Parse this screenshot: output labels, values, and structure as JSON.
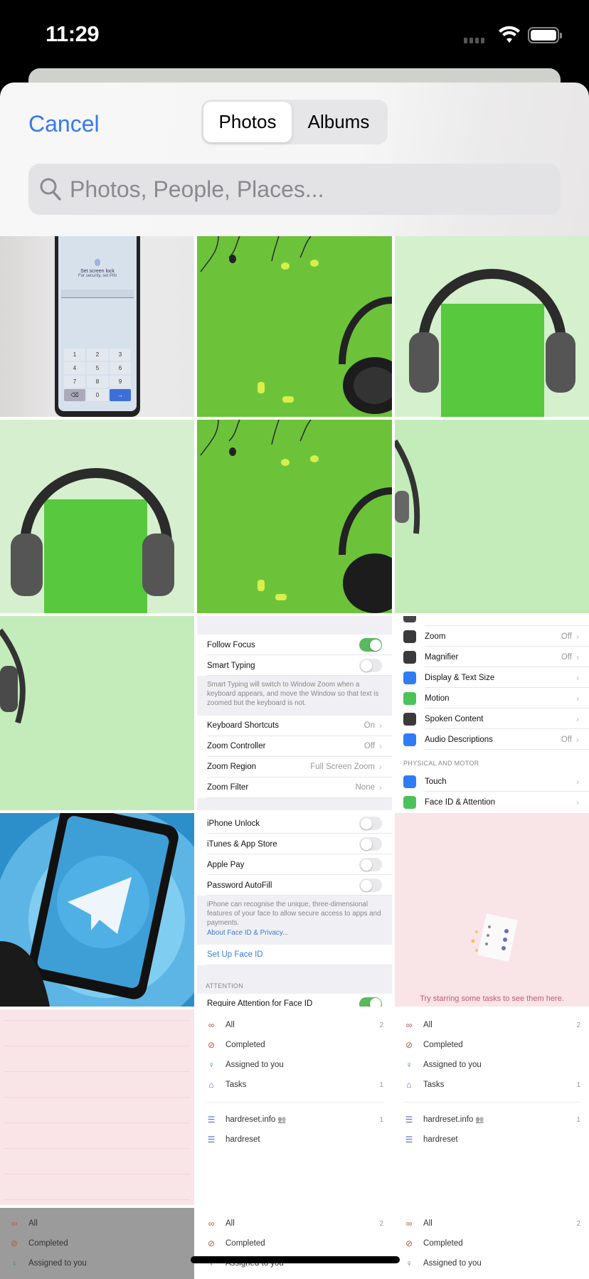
{
  "status_bar": {
    "time": "11:29"
  },
  "header": {
    "cancel_label": "Cancel",
    "tabs": [
      {
        "label": "Photos",
        "selected": true
      },
      {
        "label": "Albums",
        "selected": false
      }
    ],
    "search_placeholder": "Photos, People, Places..."
  },
  "colors": {
    "accent": "#3478f6",
    "toggle_on": "#5cb85c",
    "pink_bg": "#f9e4e8",
    "photo_green": "#6cc33a"
  },
  "photos": {
    "phone_lock": {
      "title": "Set screen lock",
      "subtitle": "For security, set PIN",
      "keys": [
        "1",
        "2",
        "3",
        "4",
        "5",
        "6",
        "7",
        "8",
        "9",
        "⌫",
        "0",
        "→"
      ]
    },
    "zoom_settings": {
      "rows": [
        {
          "type": "gap"
        },
        {
          "type": "row",
          "label": "Follow Focus",
          "toggle": true
        },
        {
          "type": "row",
          "label": "Smart Typing",
          "toggle": false
        },
        {
          "type": "footer",
          "text": "Smart Typing will switch to Window Zoom when a keyboard appears, and move the Window so that text is zoomed but the keyboard is not."
        },
        {
          "type": "row",
          "label": "Keyboard Shortcuts",
          "value": "On"
        },
        {
          "type": "row",
          "label": "Zoom Controller",
          "value": "Off"
        },
        {
          "type": "row",
          "label": "Zoom Region",
          "value": "Full Screen Zoom"
        },
        {
          "type": "row",
          "label": "Zoom Filter",
          "value": "None"
        },
        {
          "type": "gap"
        }
      ]
    },
    "accessibility_settings": {
      "rows": [
        {
          "type": "row",
          "label": "",
          "icon": "partial-icon",
          "icon_color": "#444"
        },
        {
          "type": "row",
          "label": "Zoom",
          "value": "Off",
          "icon": "zoom-icon",
          "icon_color": "#3a3a3c"
        },
        {
          "type": "row",
          "label": "Magnifier",
          "value": "Off",
          "icon": "magnifier-icon",
          "icon_color": "#3a3a3c"
        },
        {
          "type": "row",
          "label": "Display & Text Size",
          "value": "",
          "icon": "text-size-icon",
          "icon_color": "#2f7cf6"
        },
        {
          "type": "row",
          "label": "Motion",
          "value": "",
          "icon": "motion-icon",
          "icon_color": "#4cc25a"
        },
        {
          "type": "row",
          "label": "Spoken Content",
          "value": "",
          "icon": "spoken-content-icon",
          "icon_color": "#3a3a3c"
        },
        {
          "type": "row",
          "label": "Audio Descriptions",
          "value": "Off",
          "icon": "audio-descriptions-icon",
          "icon_color": "#2f7cf6"
        },
        {
          "type": "header",
          "text": "PHYSICAL AND MOTOR"
        },
        {
          "type": "row",
          "label": "Touch",
          "value": "",
          "icon": "touch-icon",
          "icon_color": "#2f7cf6"
        },
        {
          "type": "row",
          "label": "Face ID & Attention",
          "value": "",
          "icon": "face-id-icon",
          "icon_color": "#4cc25a"
        }
      ]
    },
    "faceid_settings": {
      "rows": [
        {
          "type": "row",
          "label": "iPhone Unlock",
          "toggle": false
        },
        {
          "type": "row",
          "label": "iTunes & App Store",
          "toggle": false
        },
        {
          "type": "row",
          "label": "Apple Pay",
          "toggle": false
        },
        {
          "type": "row",
          "label": "Password AutoFill",
          "toggle": false
        },
        {
          "type": "footer",
          "text": "iPhone can recognise the unique, three-dimensional features of your face to allow secure access to apps and payments.",
          "link": "About Face ID & Privacy..."
        },
        {
          "type": "link",
          "label": "Set Up Face ID"
        },
        {
          "type": "header",
          "text": "ATTENTION"
        },
        {
          "type": "row",
          "label": "Require Attention for Face ID",
          "toggle": true
        }
      ]
    },
    "starred_empty": {
      "message": "Try starring some tasks to see them here."
    },
    "task_list": {
      "items": [
        {
          "label": "All",
          "count": "2",
          "icon": "infinity-icon",
          "color": "#b5553f",
          "glyph": "∞"
        },
        {
          "label": "Completed",
          "count": "",
          "icon": "check-circle-icon",
          "color": "#b5553f",
          "glyph": "⊘"
        },
        {
          "label": "Assigned to you",
          "count": "",
          "icon": "person-icon",
          "color": "#3c8a5a",
          "glyph": "♀"
        },
        {
          "label": "Tasks",
          "count": "1",
          "icon": "home-icon",
          "color": "#5a68c8",
          "glyph": "⌂"
        }
      ],
      "lists": [
        {
          "label": "hardreset.info",
          "count": "1",
          "shared": true,
          "icon": "list-icon"
        },
        {
          "label": "hardreset",
          "count": "",
          "shared": false,
          "icon": "list-icon"
        }
      ]
    }
  }
}
